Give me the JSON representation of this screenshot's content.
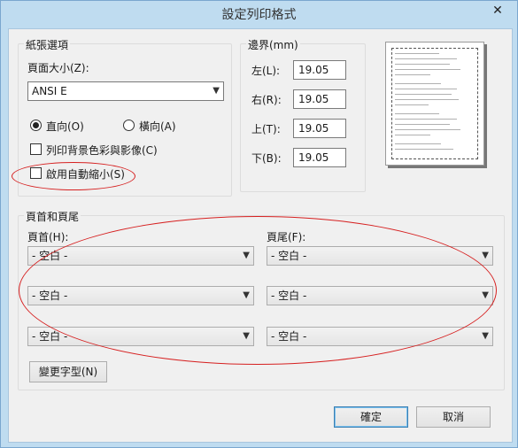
{
  "window": {
    "title": "設定列印格式",
    "close_symbol": "✕"
  },
  "paper_options": {
    "group_label": "紙張選項",
    "size_label": "頁面大小(Z):",
    "size_value": "ANSI E",
    "portrait_label": "直向(O)",
    "landscape_label": "橫向(A)",
    "orientation_selected": "portrait",
    "print_background_label": "列印背景色彩與影像(C)",
    "print_background_checked": false,
    "shrink_to_fit_label": "啟用自動縮小(S)",
    "shrink_to_fit_checked": false
  },
  "margins": {
    "group_label": "邊界(mm)",
    "left_label": "左(L):",
    "left_value": "19.05",
    "right_label": "右(R):",
    "right_value": "19.05",
    "top_label": "上(T):",
    "top_value": "19.05",
    "bottom_label": "下(B):",
    "bottom_value": "19.05"
  },
  "header_footer": {
    "group_label": "頁首和頁尾",
    "header_label": "頁首(H):",
    "footer_label": "頁尾(F):",
    "header_values": [
      "- 空白 -",
      "- 空白 -",
      "- 空白 -"
    ],
    "footer_values": [
      "- 空白 -",
      "- 空白 -",
      "- 空白 -"
    ],
    "change_font_label": "變更字型(N)"
  },
  "buttons": {
    "ok_label": "確定",
    "cancel_label": "取消"
  },
  "colors": {
    "titlebar": "#bfdcf0",
    "dialog_bg": "#f0f0f0",
    "annotation": "#d62020",
    "default_button_border": "#3c7fb1"
  },
  "icons": {
    "dropdown": "chevron-down-icon",
    "close": "close-icon"
  }
}
